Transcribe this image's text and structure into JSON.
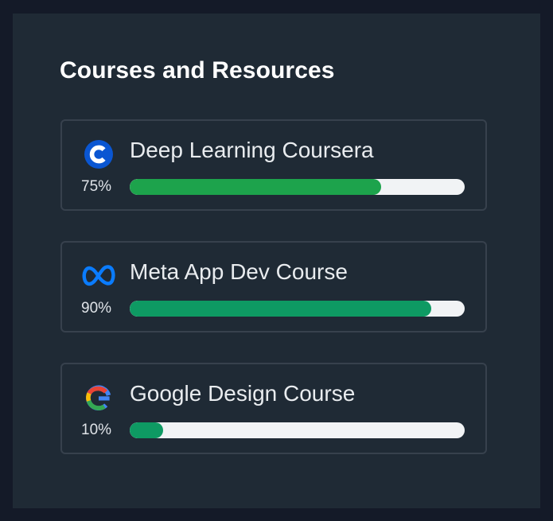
{
  "panel": {
    "title": "Courses and Resources"
  },
  "courses": [
    {
      "name": "Deep Learning Coursera",
      "progress_label": "75%",
      "progress": 75,
      "icon": "coursera-icon",
      "bar_color": "#1da34c"
    },
    {
      "name": "Meta App Dev Course",
      "progress_label": "90%",
      "progress": 90,
      "icon": "meta-icon",
      "bar_color": "#0e9a63"
    },
    {
      "name": "Google Design Course",
      "progress_label": "10%",
      "progress": 10,
      "icon": "google-icon",
      "bar_color": "#0e9a63"
    }
  ],
  "colors": {
    "background": "#141a28",
    "panel": "#1f2a35",
    "card_border": "#37414d",
    "track": "#f1f3f5",
    "coursera_blue": "#0a56d2",
    "meta_blue": "#0a7cff"
  }
}
